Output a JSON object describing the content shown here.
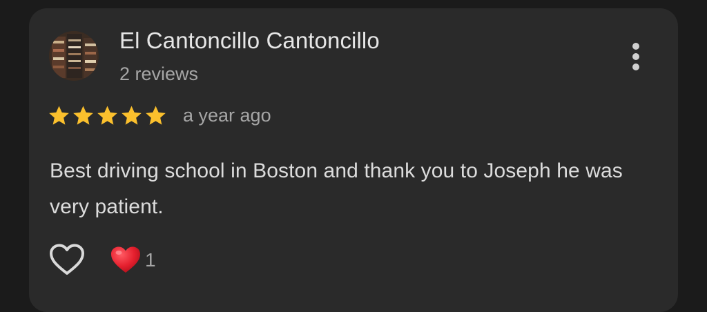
{
  "review": {
    "author_name": "El Cantoncillo Cantoncillo",
    "review_count": "2 reviews",
    "rating": 5,
    "rating_max": 5,
    "time": "a year ago",
    "text": "Best driving school in Boston and thank you to Joseph he was very patient.",
    "reaction_count": "1"
  },
  "icons": {
    "avatar": "profile-photo",
    "more": "more-vertical-icon",
    "star": "star-icon",
    "like": "heart-outline-icon",
    "reaction": "red-heart-emoji"
  },
  "colors": {
    "card_background": "#2a2a2a",
    "page_background": "#1b1b1b",
    "star": "#fbc02d",
    "heart": "#e5202e",
    "primary_text": "#e6e6e6",
    "secondary_text": "#a6a6a6"
  }
}
